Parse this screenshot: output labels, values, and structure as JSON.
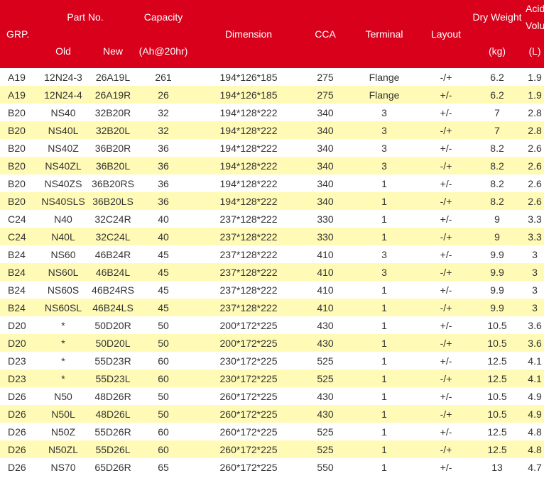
{
  "header": {
    "grp": "GRP.",
    "part_no": "Part No.",
    "old": "Old",
    "new": "New",
    "capacity": "Capacity",
    "capacity_unit": "(Ah@20hr)",
    "dimension": "Dimension",
    "cca": "CCA",
    "terminal": "Terminal",
    "layout": "Layout",
    "dry_weight": "Dry Weight",
    "dry_weight_unit": "(kg)",
    "acid_line1": "Acid",
    "acid_line2": "Volume",
    "acid_unit": "(L)"
  },
  "rows": [
    {
      "grp": "A19",
      "old": "12N24-3",
      "new": "26A19L",
      "capacity": "261",
      "dimension": "194*126*185",
      "cca": "275",
      "terminal": "Flange",
      "layout": "-/+",
      "dry_weight": "6.2",
      "acid": "1.9"
    },
    {
      "grp": "A19",
      "old": "12N24-4",
      "new": "26A19R",
      "capacity": "26",
      "dimension": "194*126*185",
      "cca": "275",
      "terminal": "Flange",
      "layout": "+/-",
      "dry_weight": "6.2",
      "acid": "1.9"
    },
    {
      "grp": "B20",
      "old": "NS40",
      "new": "32B20R",
      "capacity": "32",
      "dimension": "194*128*222",
      "cca": "340",
      "terminal": "3",
      "layout": "+/-",
      "dry_weight": "7",
      "acid": "2.8"
    },
    {
      "grp": "B20",
      "old": "NS40L",
      "new": "32B20L",
      "capacity": "32",
      "dimension": "194*128*222",
      "cca": "340",
      "terminal": "3",
      "layout": "-/+",
      "dry_weight": "7",
      "acid": "2.8"
    },
    {
      "grp": "B20",
      "old": "NS40Z",
      "new": "36B20R",
      "capacity": "36",
      "dimension": "194*128*222",
      "cca": "340",
      "terminal": "3",
      "layout": "+/-",
      "dry_weight": "8.2",
      "acid": "2.6"
    },
    {
      "grp": "B20",
      "old": "NS40ZL",
      "new": "36B20L",
      "capacity": "36",
      "dimension": "194*128*222",
      "cca": "340",
      "terminal": "3",
      "layout": "-/+",
      "dry_weight": "8.2",
      "acid": "2.6"
    },
    {
      "grp": "B20",
      "old": "NS40ZS",
      "new": "36B20RS",
      "capacity": "36",
      "dimension": "194*128*222",
      "cca": "340",
      "terminal": "1",
      "layout": "+/-",
      "dry_weight": "8.2",
      "acid": "2.6"
    },
    {
      "grp": "B20",
      "old": "NS40SLS",
      "new": "36B20LS",
      "capacity": "36",
      "dimension": "194*128*222",
      "cca": "340",
      "terminal": "1",
      "layout": "-/+",
      "dry_weight": "8.2",
      "acid": "2.6"
    },
    {
      "grp": "C24",
      "old": "N40",
      "new": "32C24R",
      "capacity": "40",
      "dimension": "237*128*222",
      "cca": "330",
      "terminal": "1",
      "layout": "+/-",
      "dry_weight": "9",
      "acid": "3.3"
    },
    {
      "grp": "C24",
      "old": "N40L",
      "new": "32C24L",
      "capacity": "40",
      "dimension": "237*128*222",
      "cca": "330",
      "terminal": "1",
      "layout": "-/+",
      "dry_weight": "9",
      "acid": "3.3"
    },
    {
      "grp": "B24",
      "old": "NS60",
      "new": "46B24R",
      "capacity": "45",
      "dimension": "237*128*222",
      "cca": "410",
      "terminal": "3",
      "layout": "+/-",
      "dry_weight": "9.9",
      "acid": "3"
    },
    {
      "grp": "B24",
      "old": "NS60L",
      "new": "46B24L",
      "capacity": "45",
      "dimension": "237*128*222",
      "cca": "410",
      "terminal": "3",
      "layout": "-/+",
      "dry_weight": "9.9",
      "acid": "3"
    },
    {
      "grp": "B24",
      "old": "NS60S",
      "new": "46B24RS",
      "capacity": "45",
      "dimension": "237*128*222",
      "cca": "410",
      "terminal": "1",
      "layout": "+/-",
      "dry_weight": "9.9",
      "acid": "3"
    },
    {
      "grp": "B24",
      "old": "NS60SL",
      "new": "46B24LS",
      "capacity": "45",
      "dimension": "237*128*222",
      "cca": "410",
      "terminal": "1",
      "layout": "-/+",
      "dry_weight": "9.9",
      "acid": "3"
    },
    {
      "grp": "D20",
      "old": "*",
      "new": "50D20R",
      "capacity": "50",
      "dimension": "200*172*225",
      "cca": "430",
      "terminal": "1",
      "layout": "+/-",
      "dry_weight": "10.5",
      "acid": "3.6"
    },
    {
      "grp": "D20",
      "old": "*",
      "new": "50D20L",
      "capacity": "50",
      "dimension": "200*172*225",
      "cca": "430",
      "terminal": "1",
      "layout": "-/+",
      "dry_weight": "10.5",
      "acid": "3.6"
    },
    {
      "grp": "D23",
      "old": "*",
      "new": "55D23R",
      "capacity": "60",
      "dimension": "230*172*225",
      "cca": "525",
      "terminal": "1",
      "layout": "+/-",
      "dry_weight": "12.5",
      "acid": "4.1"
    },
    {
      "grp": "D23",
      "old": "*",
      "new": "55D23L",
      "capacity": "60",
      "dimension": "230*172*225",
      "cca": "525",
      "terminal": "1",
      "layout": "-/+",
      "dry_weight": "12.5",
      "acid": "4.1"
    },
    {
      "grp": "D26",
      "old": "N50",
      "new": "48D26R",
      "capacity": "50",
      "dimension": "260*172*225",
      "cca": "430",
      "terminal": "1",
      "layout": "+/-",
      "dry_weight": "10.5",
      "acid": "4.9"
    },
    {
      "grp": "D26",
      "old": "N50L",
      "new": "48D26L",
      "capacity": "50",
      "dimension": "260*172*225",
      "cca": "430",
      "terminal": "1",
      "layout": "-/+",
      "dry_weight": "10.5",
      "acid": "4.9"
    },
    {
      "grp": "D26",
      "old": "N50Z",
      "new": "55D26R",
      "capacity": "60",
      "dimension": "260*172*225",
      "cca": "525",
      "terminal": "1",
      "layout": "+/-",
      "dry_weight": "12.5",
      "acid": "4.8"
    },
    {
      "grp": "D26",
      "old": "N50ZL",
      "new": "55D26L",
      "capacity": "60",
      "dimension": "260*172*225",
      "cca": "525",
      "terminal": "1",
      "layout": "-/+",
      "dry_weight": "12.5",
      "acid": "4.8"
    },
    {
      "grp": "D26",
      "old": "NS70",
      "new": "65D26R",
      "capacity": "65",
      "dimension": "260*172*225",
      "cca": "550",
      "terminal": "1",
      "layout": "+/-",
      "dry_weight": "13",
      "acid": "4.7"
    }
  ],
  "colors": {
    "header_bg": "#d9001b",
    "header_text": "#ffffff",
    "row_odd": "#ffffff",
    "row_even": "#fffbb6",
    "body_text": "#333333"
  }
}
